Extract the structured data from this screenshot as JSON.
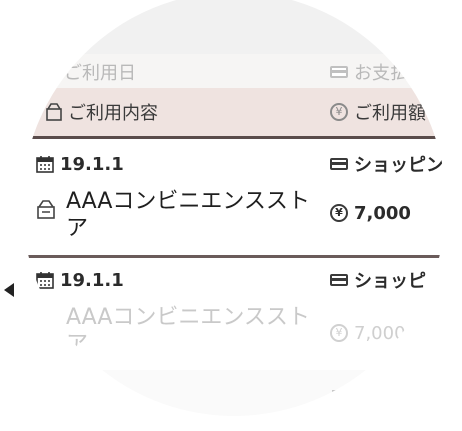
{
  "header": {
    "col1_top_label": "ご利用日",
    "col2_top_label": "お支払",
    "col1_label": "ご利用内容",
    "col2_label": "ご利用額"
  },
  "rows": [
    {
      "date": "19.1.1",
      "payment": "ショッピン",
      "store": "AAAコンビニエンスストア",
      "amount": "7,000"
    },
    {
      "date": "19.1.1",
      "payment": "ショッピ",
      "store": "AAAコンビニエンスストア",
      "amount": "7,000"
    }
  ],
  "icons": {
    "calendar": "calendar-icon",
    "shop": "shop-icon",
    "card": "credit-card-icon",
    "yen": "yen-icon",
    "arrow": "left-arrow-icon",
    "list": "list-icon"
  },
  "colors": {
    "header_band": "#efe3e0",
    "separator": "#5a4c4b"
  }
}
